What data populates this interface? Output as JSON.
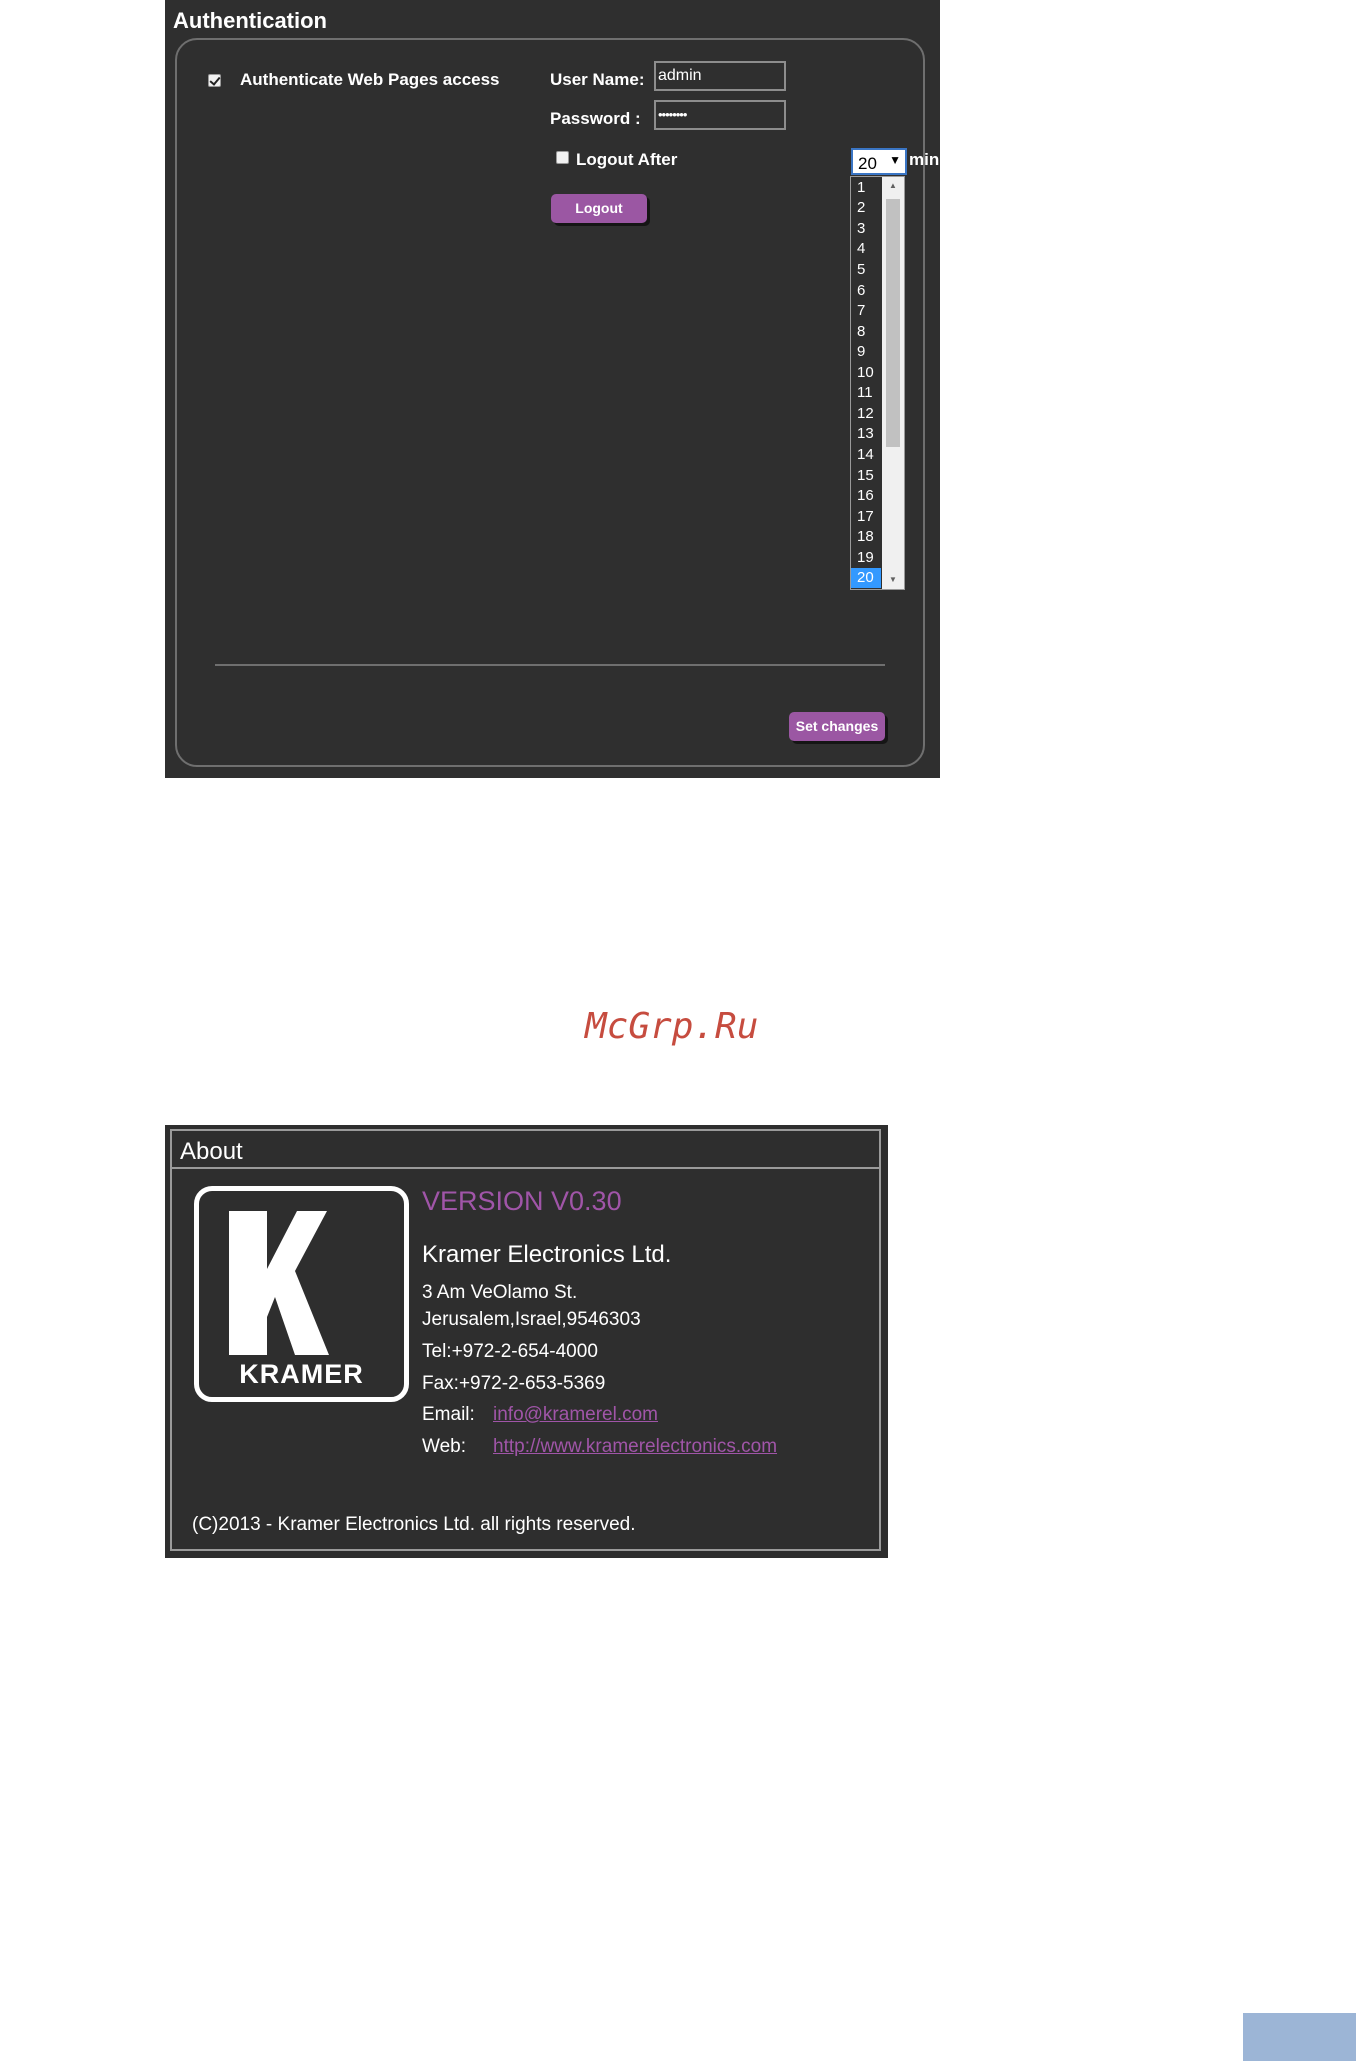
{
  "auth": {
    "title": "Authentication",
    "authenticate_label": "Authenticate Web Pages access",
    "authenticate_checked": true,
    "username_label": "User Name:",
    "username_value": "admin",
    "password_label": "Password :",
    "password_value": "••••••••",
    "logout_after_label": "Logout After",
    "logout_after_checked": false,
    "minutes_label": "minutes of innactivity",
    "selected_minutes": "20",
    "dropdown_options": [
      "1",
      "2",
      "3",
      "4",
      "5",
      "6",
      "7",
      "8",
      "9",
      "10",
      "11",
      "12",
      "13",
      "14",
      "15",
      "16",
      "17",
      "18",
      "19",
      "20"
    ],
    "logout_button": "Logout",
    "set_changes_button": "Set changes"
  },
  "watermark": "McGrp.Ru",
  "about": {
    "title": "About",
    "logo_text": "KRAMER",
    "version": "VERSION V0.30",
    "company": "Kramer Electronics Ltd.",
    "address_line1": "3 Am VeOlamo St.",
    "address_line2": "Jerusalem,Israel,9546303",
    "tel": "Tel:+972-2-654-4000",
    "fax": "Fax:+972-2-653-5369",
    "email_label": "Email:",
    "email_value": "info@kramerel.com",
    "web_label": "Web:",
    "web_value": "http://www.kramerelectronics.com",
    "copyright": "(C)2013 - Kramer Electronics Ltd. all rights reserved."
  },
  "colors": {
    "panel_bg": "#2f2f2f",
    "accent_purple": "#9b57a3",
    "selected_blue": "#3399ff",
    "page_tab": "#9cb5d6"
  },
  "icons": {
    "checkbox_checked": "check-icon",
    "dropdown_arrow": "chevron-down-icon"
  }
}
